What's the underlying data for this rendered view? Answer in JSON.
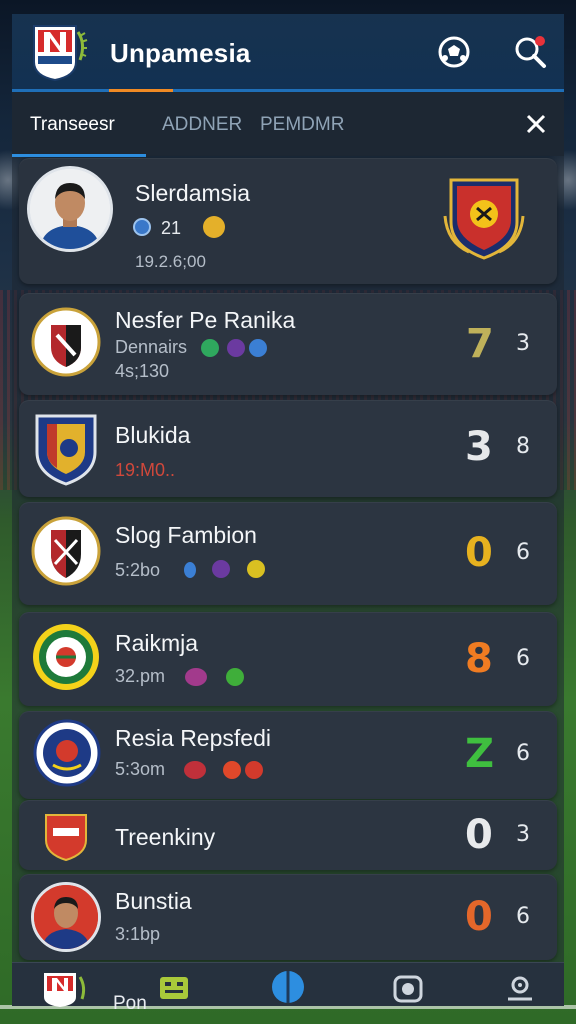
{
  "app": {
    "title": "Unpamesia"
  },
  "tabs": [
    {
      "label": "Transeesr",
      "active": true
    },
    {
      "label": "ADDNER",
      "active": false
    },
    {
      "label": "PEMDMR",
      "active": false
    }
  ],
  "featured": {
    "name": "Slerdamsia",
    "stat": "21",
    "time": "19.2.6;00"
  },
  "rows": [
    {
      "name": "Nesfer Pe Ranika",
      "sub": "Dennairs",
      "time": "4s;130",
      "score": "7",
      "score_color": "#bfb15a",
      "pts": "3"
    },
    {
      "name": "Blukida",
      "sub": "19:M0..",
      "score": "3",
      "score_color": "#e6e8ea",
      "pts": "8"
    },
    {
      "name": "Slog Fambion",
      "sub": "5:2bo",
      "score": "0",
      "score_color": "#e7b21f",
      "pts": "6"
    },
    {
      "name": "Raikmja",
      "sub": "32.pm",
      "score": "8",
      "score_color": "#f07c22",
      "pts": "6"
    },
    {
      "name": "Resia Repsfedi",
      "sub": "5:3om",
      "score": "Z",
      "score_color": "#3fbf3f",
      "pts": "6"
    },
    {
      "name": "Treenkiny",
      "sub": "",
      "score": "0",
      "score_color": "#e8eaec",
      "pts": "3"
    },
    {
      "name": "Bunstia",
      "sub": "3:1bp",
      "score": "0",
      "score_color": "#e4672a",
      "pts": "6"
    }
  ],
  "bottom_nav": {
    "label": "Pon"
  },
  "colors": {
    "header": "#17324f",
    "accent": "#f08a24",
    "tab_active": "#2d8ee0",
    "card": "#2c3541"
  },
  "icons": [
    "soccer-ball-icon",
    "search-icon",
    "close-icon",
    "club-crest-icon",
    "bracket-icon",
    "globe-icon",
    "camera-icon",
    "profile-icon"
  ]
}
